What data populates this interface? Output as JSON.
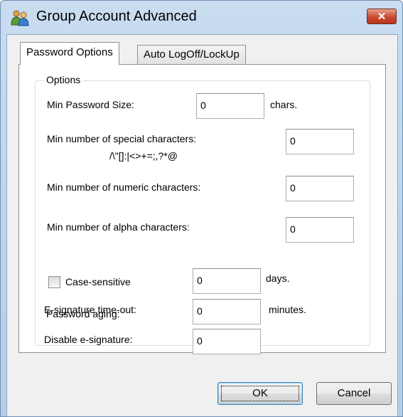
{
  "window": {
    "title": "Group Account Advanced",
    "close_label": "✕"
  },
  "tabs": [
    {
      "label": "Password Options",
      "active": true
    },
    {
      "label": "Auto LogOff/LockUp",
      "active": false
    }
  ],
  "options": {
    "group_title": "Options",
    "min_password_size": {
      "label": "Min Password Size:",
      "value": "0",
      "unit": "chars."
    },
    "min_special": {
      "label": "Min number of special characters:",
      "chars_hint": "/\\\"[]:|<>+=;,?*@",
      "value": "0"
    },
    "min_numeric": {
      "label": "Min number of numeric characters:",
      "value": "0"
    },
    "min_alpha": {
      "label": "Min number of alpha characters:",
      "value": "0"
    },
    "case_sensitive": {
      "label": "Case-sensitive",
      "checked": false
    },
    "password_aging": {
      "label": "Password aging:",
      "value": "0",
      "unit": "days."
    },
    "esig_timeout": {
      "label": "E-signature time-out:",
      "value": "0",
      "unit": "minutes."
    },
    "disable_esig": {
      "label": "Disable e-signature:",
      "value": "0"
    }
  },
  "buttons": {
    "ok": "OK",
    "cancel": "Cancel"
  },
  "colors": {
    "title_bar": "#c9dcf0",
    "close_button": "#c94a30",
    "dialog_bg": "#f0f0f0",
    "focus_border": "#3c7fb1"
  }
}
